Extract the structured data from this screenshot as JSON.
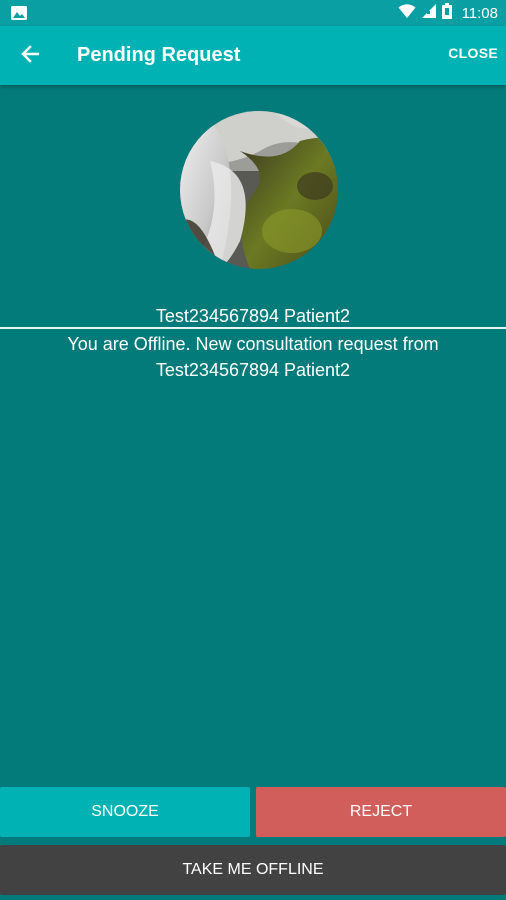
{
  "status_bar": {
    "time": "11:08",
    "icons": [
      "image-icon",
      "wifi-icon",
      "signal-icon",
      "battery-icon"
    ],
    "background": "#0a9fa2"
  },
  "app_bar": {
    "title": "Pending Request",
    "close_label": "CLOSE",
    "back_icon": "back-arrow-icon",
    "background": "#00b2b4"
  },
  "main": {
    "avatar_image": "waterfall-profile-photo",
    "patient_name": "Test234567894 Patient2",
    "message": "You are Offline. New consultation request from Test234567894 Patient2",
    "background": "#037b7b"
  },
  "actions": {
    "snooze_label": "SNOOZE",
    "reject_label": "REJECT",
    "offline_label": "TAKE ME OFFLINE",
    "snooze_color": "#00b2b4",
    "reject_color": "#d15e5b",
    "offline_color": "#424242"
  }
}
